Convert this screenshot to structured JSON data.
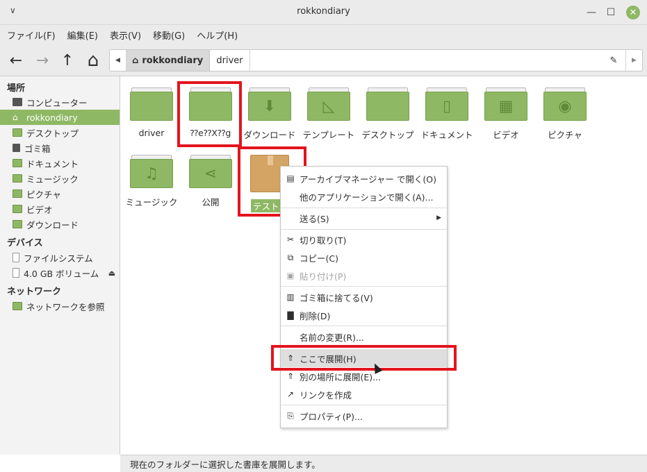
{
  "window": {
    "title": "rokkondiary",
    "minimize": "—",
    "maximize": "☐",
    "close": "✕"
  },
  "menubar": [
    "ファイル(F)",
    "編集(E)",
    "表示(V)",
    "移動(G)",
    "ヘルプ(H)"
  ],
  "toolbar": {
    "back": "←",
    "forward": "→",
    "up": "↑",
    "home": "⌂"
  },
  "pathbar": {
    "left_arrow": "◀",
    "active": "rokkondiary",
    "next": "driver",
    "edit_icon": "✎",
    "right_arrow": "▶"
  },
  "sidebar": {
    "places_header": "場所",
    "places": [
      "コンピューター",
      "rokkondiary",
      "デスクトップ",
      "ゴミ箱",
      "ドキュメント",
      "ミュージック",
      "ピクチャ",
      "ビデオ",
      "ダウンロード"
    ],
    "devices_header": "デバイス",
    "devices": [
      "ファイルシステム",
      "4.0 GB ボリューム"
    ],
    "network_header": "ネットワーク",
    "network": [
      "ネットワークを参照"
    ],
    "eject_icon": "⏏"
  },
  "files": [
    {
      "name": "driver",
      "glyph": ""
    },
    {
      "name": "⁇e⁇X⁇g",
      "glyph": ""
    },
    {
      "name": "ダウンロード",
      "glyph": "⬇"
    },
    {
      "name": "テンプレート",
      "glyph": "◺"
    },
    {
      "name": "デスクトップ",
      "glyph": ""
    },
    {
      "name": "ドキュメント",
      "glyph": "▯"
    },
    {
      "name": "ビデオ",
      "glyph": "▦"
    },
    {
      "name": "ピクチャ",
      "glyph": "◉"
    },
    {
      "name": "ミュージック",
      "glyph": "♫"
    },
    {
      "name": "公開",
      "glyph": "⋖"
    },
    {
      "name": "テスト.z",
      "glyph": ""
    }
  ],
  "context_menu": {
    "items": [
      {
        "label": "アーカイブマネージャー で開く(O)",
        "icon": "▤"
      },
      {
        "label": "他のアプリケーションで開く(A)...",
        "icon": ""
      },
      {
        "label": "送る(S)",
        "icon": "",
        "submenu": "▶"
      },
      {
        "label": "切り取り(T)",
        "icon": "✂"
      },
      {
        "label": "コピー(C)",
        "icon": "⧉"
      },
      {
        "label": "貼り付け(P)",
        "icon": "▣"
      },
      {
        "label": "ゴミ箱に捨てる(V)",
        "icon": "▥"
      },
      {
        "label": "削除(D)",
        "icon": "▇"
      },
      {
        "label": "名前の変更(R)...",
        "icon": ""
      },
      {
        "label": "ここで展開(H)",
        "icon": "⇑"
      },
      {
        "label": "別の場所に展開(E)...",
        "icon": "⇑"
      },
      {
        "label": "リンクを作成",
        "icon": "↗"
      },
      {
        "label": "プロパティ(P)...",
        "icon": "⎘"
      }
    ]
  },
  "statusbar": {
    "text": "現在のフォルダーに選択した書庫を展開します。"
  },
  "colors": {
    "accent": "#8fb864",
    "highlight_box": "#e3141d"
  }
}
